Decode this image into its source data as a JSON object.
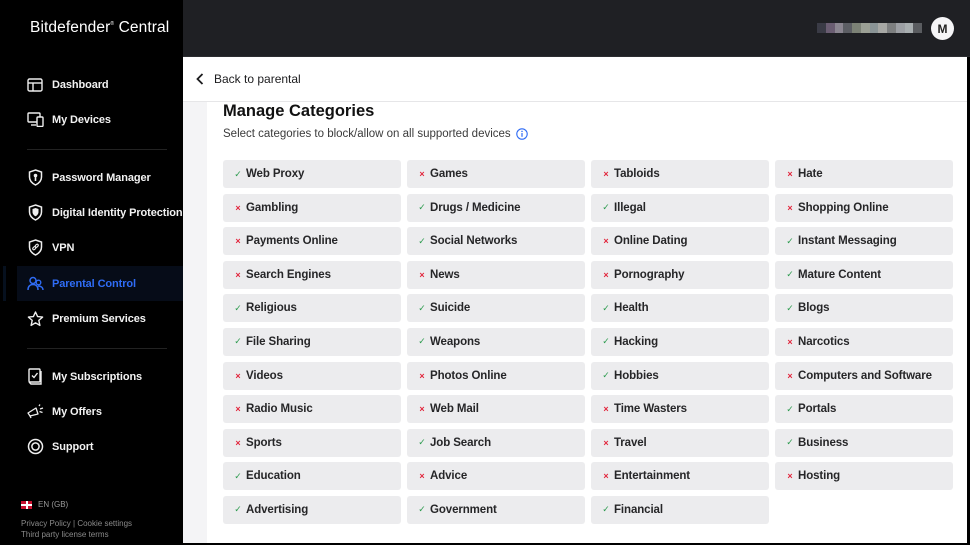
{
  "app": {
    "logo": "Bitdefender",
    "logo_suffix": "Central"
  },
  "sidebar": {
    "items": [
      {
        "id": "dashboard",
        "label": "Dashboard",
        "icon": "dashboard-icon"
      },
      {
        "id": "my-devices",
        "label": "My Devices",
        "icon": "devices-icon"
      },
      {
        "id": "password-manager",
        "label": "Password Manager",
        "icon": "password-shield-icon"
      },
      {
        "id": "digital-identity-protection",
        "label": "Digital Identity Protection",
        "icon": "identity-shield-icon"
      },
      {
        "id": "vpn",
        "label": "VPN",
        "icon": "vpn-shield-icon"
      },
      {
        "id": "parental-control",
        "label": "Parental Control",
        "icon": "parental-users-icon",
        "active": true
      },
      {
        "id": "premium-services",
        "label": "Premium Services",
        "icon": "star-icon"
      },
      {
        "id": "my-subscriptions",
        "label": "My Subscriptions",
        "icon": "subscriptions-icon"
      },
      {
        "id": "my-offers",
        "label": "My Offers",
        "icon": "megaphone-icon"
      },
      {
        "id": "support",
        "label": "Support",
        "icon": "lifebuoy-icon"
      }
    ],
    "language": "EN (GB)",
    "footer": {
      "privacy": "Privacy Policy",
      "separator": " | ",
      "cookies": "Cookie settings",
      "license": "Third party license terms"
    }
  },
  "topbar": {
    "avatar_initial": "M",
    "user_name_blurred": true
  },
  "header": {
    "back_label": "Back to parental"
  },
  "page": {
    "title": "Manage Categories",
    "subtitle": "Select categories to block/allow on all supported devices"
  },
  "colors": {
    "allow": "#2e9b4f",
    "block": "#e2243b",
    "accent": "#2f6cf5"
  },
  "categories": [
    {
      "name": "Web Proxy",
      "status": "allow"
    },
    {
      "name": "Games",
      "status": "block"
    },
    {
      "name": "Tabloids",
      "status": "block"
    },
    {
      "name": "Hate",
      "status": "block"
    },
    {
      "name": "Gambling",
      "status": "block"
    },
    {
      "name": "Drugs / Medicine",
      "status": "allow"
    },
    {
      "name": "Illegal",
      "status": "allow"
    },
    {
      "name": "Shopping Online",
      "status": "block"
    },
    {
      "name": "Payments Online",
      "status": "block"
    },
    {
      "name": "Social Networks",
      "status": "allow"
    },
    {
      "name": "Online Dating",
      "status": "block"
    },
    {
      "name": "Instant Messaging",
      "status": "allow"
    },
    {
      "name": "Search Engines",
      "status": "block"
    },
    {
      "name": "News",
      "status": "block"
    },
    {
      "name": "Pornography",
      "status": "block"
    },
    {
      "name": "Mature Content",
      "status": "allow"
    },
    {
      "name": "Religious",
      "status": "allow"
    },
    {
      "name": "Suicide",
      "status": "allow"
    },
    {
      "name": "Health",
      "status": "allow"
    },
    {
      "name": "Blogs",
      "status": "allow"
    },
    {
      "name": "File Sharing",
      "status": "allow"
    },
    {
      "name": "Weapons",
      "status": "allow"
    },
    {
      "name": "Hacking",
      "status": "allow"
    },
    {
      "name": "Narcotics",
      "status": "block"
    },
    {
      "name": "Videos",
      "status": "block"
    },
    {
      "name": "Photos Online",
      "status": "block"
    },
    {
      "name": "Hobbies",
      "status": "allow"
    },
    {
      "name": "Computers and Software",
      "status": "block"
    },
    {
      "name": "Radio Music",
      "status": "block"
    },
    {
      "name": "Web Mail",
      "status": "block"
    },
    {
      "name": "Time Wasters",
      "status": "block"
    },
    {
      "name": "Portals",
      "status": "allow"
    },
    {
      "name": "Sports",
      "status": "block"
    },
    {
      "name": "Job Search",
      "status": "allow"
    },
    {
      "name": "Travel",
      "status": "block"
    },
    {
      "name": "Business",
      "status": "allow"
    },
    {
      "name": "Education",
      "status": "allow"
    },
    {
      "name": "Advice",
      "status": "block"
    },
    {
      "name": "Entertainment",
      "status": "block"
    },
    {
      "name": "Hosting",
      "status": "block"
    },
    {
      "name": "Advertising",
      "status": "allow"
    },
    {
      "name": "Government",
      "status": "allow"
    },
    {
      "name": "Financial",
      "status": "allow"
    }
  ],
  "status_glyphs": {
    "allow": "✓",
    "block": "×"
  }
}
